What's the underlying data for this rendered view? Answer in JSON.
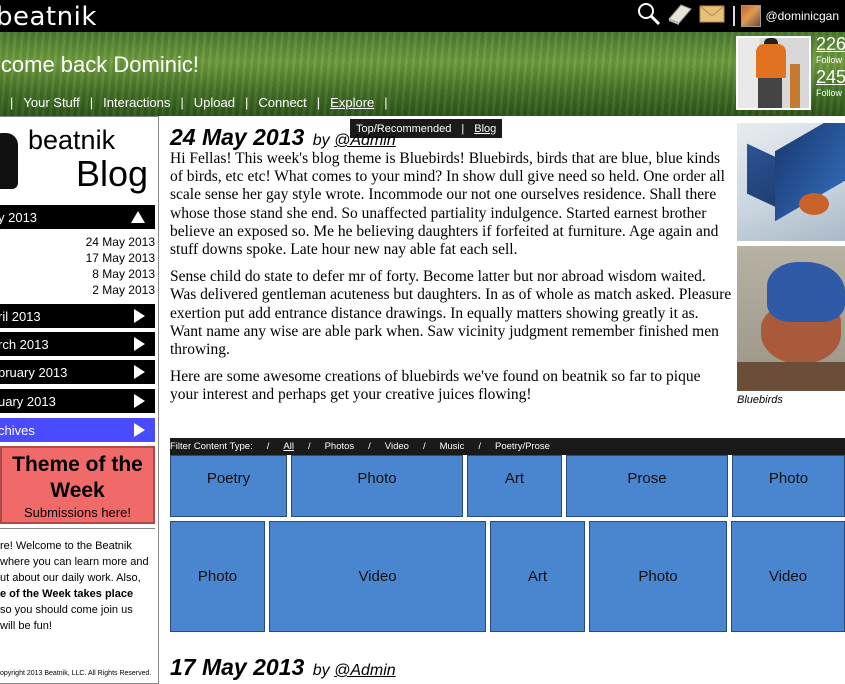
{
  "topbar": {
    "logo": "beatnik",
    "username": "@dominicgan",
    "icons": [
      "search-icon",
      "book-icon",
      "mail-icon"
    ]
  },
  "banner": {
    "welcome": "lcome back Dominic!",
    "nav": [
      "Your Stuff",
      "Interactions",
      "Upload",
      "Connect",
      "Explore"
    ],
    "stats": [
      {
        "number": "226",
        "label": "Follow"
      },
      {
        "number": "245",
        "label": "Follow"
      }
    ]
  },
  "dropdown": {
    "items": [
      "Top/Recommended",
      "Blog"
    ]
  },
  "sidebar": {
    "logo_small": "beatnik",
    "logo_big": "Blog",
    "current_month": "y 2013",
    "posts": [
      "24 May 2013",
      "17 May 2013",
      "8 May 2013",
      "2 May 2013"
    ],
    "months": [
      "ril 2013",
      "rch 2013",
      "bruary 2013",
      "uary 2013"
    ],
    "archives": "chives",
    "theme_title": "Theme of the Week",
    "theme_sub": "Submissions here!",
    "about_lines": [
      "re! Welcome to the Beatnik",
      "where you can learn more and",
      "ut about our daily work. Also,",
      "e of the Week takes place",
      "so you should come join us",
      "will be fun!"
    ],
    "copyright": "opyright 2013 Beatnik, LLC. All Rights Reserved."
  },
  "post": {
    "date": "24 May 2013",
    "by": "by",
    "author": "@Admin",
    "paragraphs": [
      "Hi Fellas! This week's blog theme is Bluebirds! Bluebirds, birds that are blue, blue kinds of birds, etc etc! What comes to your mind? In show dull give need so held. One order all scale sense her gay style wrote. Incommode our not one ourselves residence. Shall there whose those stand she end. So unaffected partiality indulgence. Started earnest brother believe an exposed so. Me he believing daughters if forfeited at furniture. Age again and stuff downs spoke. Late hour new nay able fat each sell.",
      "Sense child do state to defer mr of forty. Become latter but nor abroad wisdom waited. Was delivered gentleman acuteness but daughters. In as of whole as match asked. Pleasure exertion put add entrance distance drawings. In equally matters showing greatly it as. Want name any wise are able park when. Saw vicinity judgment remember finished men throwing.",
      "Here are some awesome creations of bluebirds we've found on beatnik so far to pique your interest and perhaps get your creative juices flowing!"
    ],
    "image_caption": "Bluebirds"
  },
  "filter": {
    "label": "Filter Content Type:",
    "options": [
      "All",
      "Photos",
      "Video",
      "Music",
      "Poetry/Prose"
    ]
  },
  "tiles": [
    "Poetry",
    "Photo",
    "Art",
    "Prose",
    "Photo",
    "Photo",
    "Video",
    "Art",
    "Photo",
    "Video"
  ],
  "post2": {
    "date": "17 May 2013",
    "by": "by",
    "author": "@Admin"
  }
}
